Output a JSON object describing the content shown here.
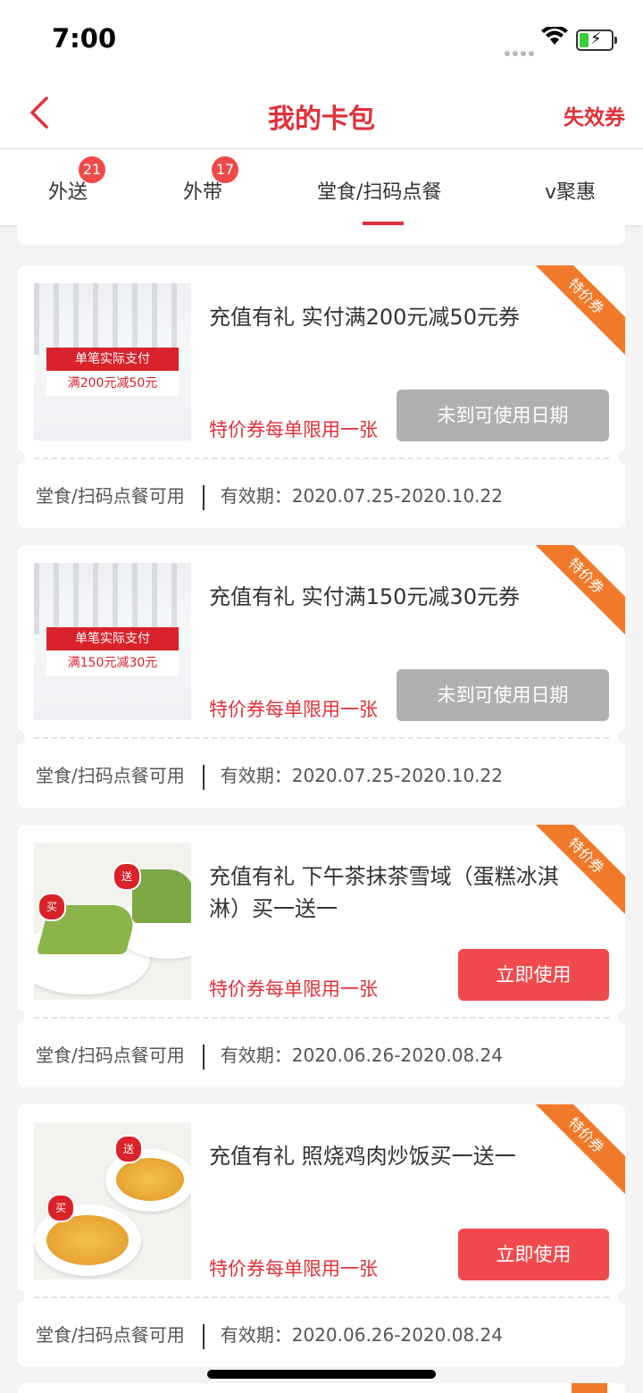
{
  "status_bar": {
    "time": "7:00"
  },
  "nav": {
    "title": "我的卡包",
    "right_action": "失效券"
  },
  "tabs": [
    {
      "label": "外送",
      "badge": "21"
    },
    {
      "label": "外带",
      "badge": "17"
    },
    {
      "label": "堂食/扫码点餐",
      "badge": ""
    },
    {
      "label": "v聚惠",
      "badge": ""
    }
  ],
  "active_tab": "堂食/扫码点餐",
  "ribbon_label": "特价券",
  "coupons": [
    {
      "name": "充值有礼 实付满200元减50元券",
      "limit": "特价券每单限用一张",
      "button": "未到可使用日期",
      "button_state": "disabled",
      "scope": "堂食/扫码点餐可用",
      "validity": "有效期：2020.07.25-2020.10.22",
      "thumb_line1": "单笔实际支付",
      "thumb_line2": "满200元减50元"
    },
    {
      "name": "充值有礼 实付满150元减30元券",
      "limit": "特价券每单限用一张",
      "button": "未到可使用日期",
      "button_state": "disabled",
      "scope": "堂食/扫码点餐可用",
      "validity": "有效期：2020.07.25-2020.10.22",
      "thumb_line1": "单笔实际支付",
      "thumb_line2": "满150元减30元"
    },
    {
      "name": "充值有礼 下午茶抹茶雪域（蛋糕冰淇淋）买一送一",
      "limit": "特价券每单限用一张",
      "button": "立即使用",
      "button_state": "active",
      "scope": "堂食/扫码点餐可用",
      "validity": "有效期：2020.06.26-2020.08.24",
      "badge_buy": "买",
      "badge_free": "送"
    },
    {
      "name": "充值有礼 照烧鸡肉炒饭买一送一",
      "limit": "特价券每单限用一张",
      "button": "立即使用",
      "button_state": "active",
      "scope": "堂食/扫码点餐可用",
      "validity": "有效期：2020.06.26-2020.08.24",
      "badge_buy": "买",
      "badge_free": "送"
    }
  ],
  "colors": {
    "brand_red": "#e0313a",
    "ribbon_orange": "#f07a2a",
    "button_red": "#f04a4e",
    "button_grey": "#b0b0b0"
  }
}
